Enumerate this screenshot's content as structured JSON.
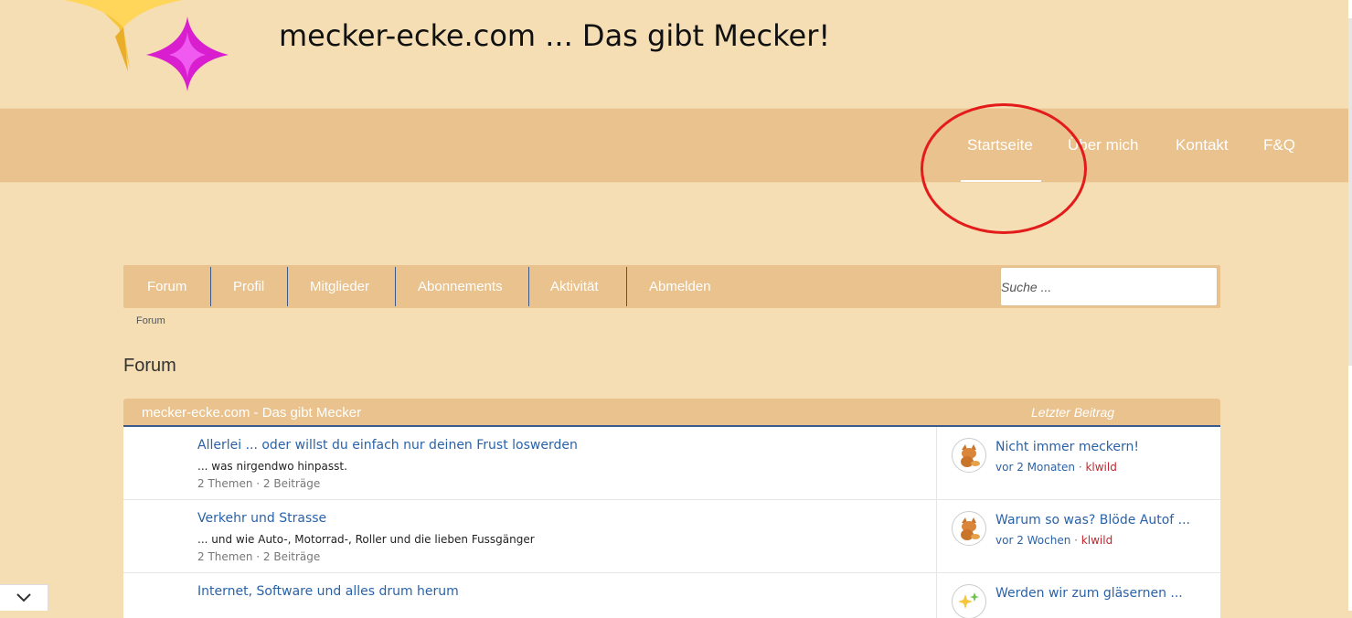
{
  "site": {
    "title": "mecker-ecke.com ... Das gibt Mecker!"
  },
  "main_nav": {
    "items": [
      {
        "label": "Startseite"
      },
      {
        "label": "Über mich"
      },
      {
        "label": "Kontakt"
      },
      {
        "label": "F&Q"
      }
    ]
  },
  "forum_nav": {
    "items": [
      {
        "label": "Forum"
      },
      {
        "label": "Profil"
      },
      {
        "label": "Mitglieder"
      },
      {
        "label": "Abonnements"
      },
      {
        "label": "Aktivität"
      },
      {
        "label": "Abmelden"
      }
    ],
    "search_placeholder": "Suche ..."
  },
  "breadcrumb": "Forum",
  "page_heading": "Forum",
  "table": {
    "title": "mecker-ecke.com - Das gibt Mecker",
    "last_post_header": "Letzter Beitrag",
    "rows": [
      {
        "title": "Allerlei ... oder willst du einfach nur deinen Frust loswerden",
        "description": "... was nirgendwo hinpasst.",
        "stats": "2 Themen · 2 Beiträge",
        "last_title": "Nicht immer meckern!",
        "last_time": "vor 2 Monaten",
        "last_user": "klwild"
      },
      {
        "title": "Verkehr und Strasse",
        "description": "... und wie Auto-, Motorrad-, Roller und die lieben Fussgänger",
        "stats": "2 Themen · 2 Beiträge",
        "last_title": "Warum so was? Blöde Autof ...",
        "last_time": "vor 2 Wochen",
        "last_user": "klwild"
      },
      {
        "title": "Internet, Software und alles drum herum",
        "description": "",
        "stats": "",
        "last_title": "Werden wir zum gläsernen ...",
        "last_time": "",
        "last_user": ""
      }
    ]
  },
  "colors": {
    "page_bg": "#f5deb3",
    "nav_bg": "#e9c28e",
    "link": "#2a62a8",
    "user": "#c0262d",
    "annotation": "#e41b1b"
  }
}
